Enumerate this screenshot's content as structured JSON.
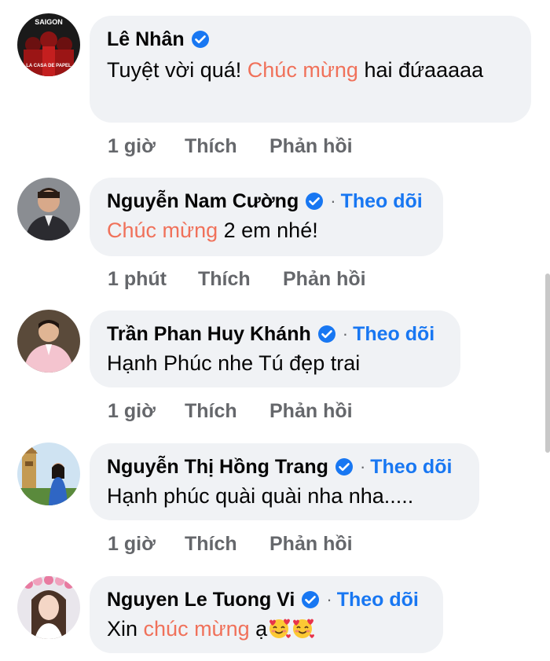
{
  "comments": [
    {
      "name": "Lê Nhân",
      "avatar_text_top": "SAIGON",
      "avatar_text_bottom": "LA CASA DE PAPEL",
      "text_pre": "Tuyệt vời quá! ",
      "text_hl": "Chúc mừng",
      "text_post": " hai đứaaaaa",
      "time": "1 giờ",
      "like": "Thích",
      "reply": "Phản hồi"
    },
    {
      "name": "Nguyễn Nam Cường",
      "follow": "Theo dõi",
      "text_hl": "Chúc mừng",
      "text_post": " 2 em nhé!",
      "time": "1 phút",
      "like": "Thích",
      "reply": "Phản hồi"
    },
    {
      "name": "Trần Phan Huy Khánh",
      "follow": "Theo dõi",
      "text": "Hạnh Phúc nhe Tú đẹp trai",
      "time": "1 giờ",
      "like": "Thích",
      "reply": "Phản hồi"
    },
    {
      "name": "Nguyễn Thị Hồng Trang",
      "follow": "Theo dõi",
      "text": "Hạnh phúc quài quài nha nha.....",
      "time": "1 giờ",
      "like": "Thích",
      "reply": "Phản hồi"
    },
    {
      "name": "Nguyen Le Tuong Vi",
      "follow": "Theo dõi",
      "text_pre": "Xin ",
      "text_hl": "chúc mừng",
      "text_post": " ạ",
      "emojis": [
        "smiling-face-with-hearts",
        "smiling-face-with-hearts"
      ]
    }
  ],
  "separator": "·",
  "colors": {
    "accent_blue": "#1877f2",
    "highlight": "#f0715a",
    "bubble_bg": "#f0f2f5",
    "muted": "#65676b"
  }
}
